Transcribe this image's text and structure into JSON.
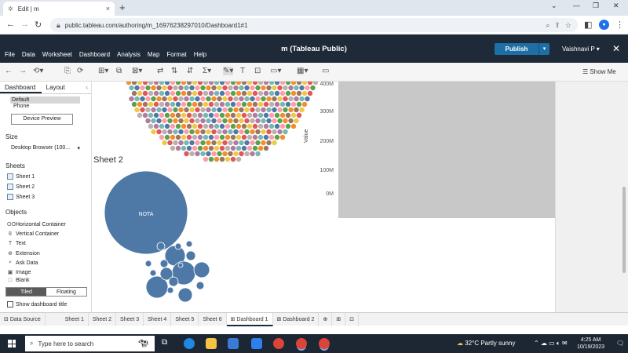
{
  "browser": {
    "tab_title": "Edit | m",
    "url": "public.tableau.com/authoring/m_16976238297010/Dashboard1#1"
  },
  "app": {
    "title": "m (Tableau Public)",
    "menu": [
      "File",
      "Data",
      "Worksheet",
      "Dashboard",
      "Analysis",
      "Map",
      "Format",
      "Help"
    ],
    "publish_label": "Publish",
    "user_label": "Vaishnavi P ▾",
    "show_me_label": "Show Me"
  },
  "left_panel": {
    "tabs": [
      "Dashboard",
      "Layout"
    ],
    "device_default": "Default",
    "device_phone": "Phone",
    "device_preview_label": "Device Preview",
    "size_heading": "Size",
    "size_value": "Desktop Browser (100...",
    "sheets_heading": "Sheets",
    "sheets": [
      "Sheet 1",
      "Sheet 2",
      "Sheet 3"
    ],
    "objects_heading": "Objects",
    "objects": [
      {
        "label": "Horizontal Container",
        "icon": "OO"
      },
      {
        "label": "Vertical Container",
        "icon": "8"
      },
      {
        "label": "Text",
        "icon": "T"
      },
      {
        "label": "Extension",
        "icon": "⊕"
      },
      {
        "label": "Ask Data",
        "icon": "⌕"
      },
      {
        "label": "Image",
        "icon": "▣"
      },
      {
        "label": "Blank",
        "icon": "□"
      }
    ],
    "tiled_label": "Tiled",
    "floating_label": "Floating",
    "show_title_label": "Show dashboard title"
  },
  "canvas": {
    "sheet2_title": "Sheet 2",
    "bubble_label": "NOTA",
    "value_axis_label": "Value",
    "value_ticks": [
      "400M",
      "300M",
      "200M",
      "100M",
      "0M"
    ],
    "colors": {
      "bubble_blue": "#4e79a7",
      "palette": [
        "#4e79a7",
        "#f28e2b",
        "#e15759",
        "#76b7b2",
        "#59a14f",
        "#edc948",
        "#b07aa1",
        "#ff9da7",
        "#9c755f",
        "#bab0ac"
      ]
    }
  },
  "sheet_tabs": [
    "Data Source",
    "Sheet 1",
    "Sheet 2",
    "Sheet 3",
    "Sheet 4",
    "Sheet 5",
    "Sheet 6",
    "Dashboard 1",
    "Dashboard 2"
  ],
  "active_sheet_tab": "Dashboard 1",
  "taskbar": {
    "search_placeholder": "Type here to search",
    "weather": "32°C  Partly sunny",
    "time": "4:25 AM",
    "date": "10/19/2023"
  }
}
